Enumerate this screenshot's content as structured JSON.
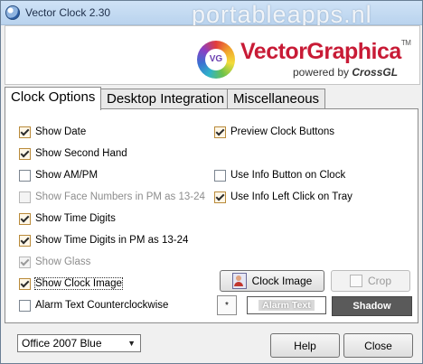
{
  "window": {
    "title": "Vector Clock 2.30",
    "watermark": "portableapps.nl"
  },
  "banner": {
    "logo_mark": "VG",
    "brand": "VectorGraphica",
    "tm": "TM",
    "powered_by": "powered by",
    "powered_brand": "CrossGL"
  },
  "tabs": [
    {
      "label": "Clock Options",
      "active": true
    },
    {
      "label": "Desktop Integration",
      "active": false
    },
    {
      "label": "Miscellaneous",
      "active": false
    }
  ],
  "options": {
    "show_date": {
      "label": "Show Date",
      "checked": true
    },
    "show_second_hand": {
      "label": "Show Second Hand",
      "checked": true
    },
    "show_ampm": {
      "label": "Show AM/PM",
      "checked": false
    },
    "show_face_numbers_pm": {
      "label": "Show Face Numbers in PM as 13-24",
      "checked": false,
      "disabled": true
    },
    "show_time_digits": {
      "label": "Show Time Digits",
      "checked": true
    },
    "show_time_digits_pm": {
      "label": "Show Time Digits in PM as 13-24",
      "checked": true
    },
    "show_glass": {
      "label": "Show Glass",
      "checked": true,
      "disabled": true
    },
    "show_clock_image": {
      "label": "Show Clock Image",
      "checked": true
    },
    "alarm_ccw": {
      "label": "Alarm Text Counterclockwise",
      "checked": false
    },
    "preview_clock_buttons": {
      "label": "Preview Clock Buttons",
      "checked": true
    },
    "use_info_button": {
      "label": "Use Info Button on Clock",
      "checked": false
    },
    "use_info_left_click": {
      "label": "Use Info Left Click on Tray",
      "checked": true
    }
  },
  "buttons": {
    "clock_image": "Clock Image",
    "crop": "Crop",
    "small": "*",
    "help": "Help",
    "close": "Close"
  },
  "previews": {
    "alarm_text": "Alarm Text",
    "shadow": "Shadow"
  },
  "theme_select": {
    "value": "Office 2007 Blue"
  }
}
